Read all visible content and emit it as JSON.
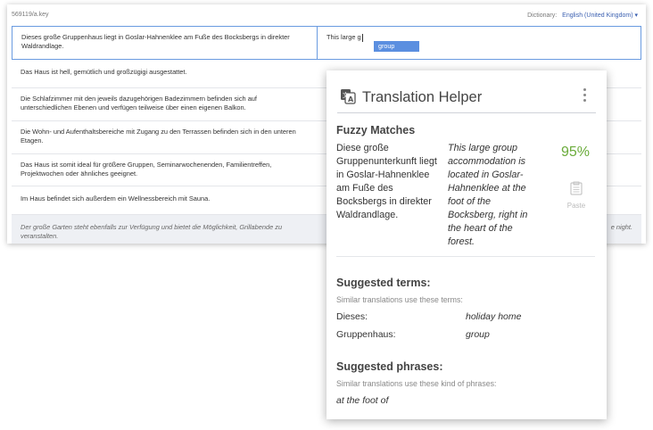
{
  "editor": {
    "file_name": "569119/a.key",
    "dictionary_label": "Dictionary:",
    "dictionary_value": "English (United Kingdom) ▾",
    "rows": [
      {
        "source": "Dieses große Gruppenhaus liegt in Goslar-Hahnenklee am Fuße des Bocksbergs in direkter Waldrandlage.",
        "target": "This large g"
      },
      {
        "source": "Das Haus ist hell, gemütlich und großzügigi ausgestattet.",
        "target": ""
      },
      {
        "source": "Die Schlafzimmer mit den jeweils dazugehörigen Badezimmern befinden sich auf unterschiedlichen Ebenen und verfügen teilweise über einen eigenen Balkon.",
        "target": ""
      },
      {
        "source": "Die Wohn- und Aufenthaltsbereiche mit Zugang zu den Terrassen befinden sich in den unteren Etagen.",
        "target": ""
      },
      {
        "source": "Das Haus ist somit ideal für größere Gruppen, Seminarwochenenden, Familientreffen, Projektwochen oder ähnliches geeignet.",
        "target": ""
      },
      {
        "source": "Im Haus befindet sich außerdem ein Wellnessbereich mit Sauna.",
        "target": ""
      },
      {
        "source": "Der große Garten steht ebenfalls zur Verfügung und bietet die Möglichkeit, Grillabende zu veranstalten.",
        "target": "e night."
      }
    ],
    "autocomplete": "group"
  },
  "helper": {
    "title": "Translation Helper",
    "fuzzy": {
      "heading": "Fuzzy Matches",
      "source": "Diese große Gruppenunterkunft liegt in Goslar-Hahnenklee am Fuße des Bocksbergs in direkter Waldrandlage.",
      "target": "This large group accommodation is located in Goslar-Hahnenklee at the foot of the Bocksberg, right in the heart of the forest.",
      "percent": "95%",
      "paste_label": "Paste"
    },
    "terms": {
      "heading": "Suggested terms:",
      "subtitle": "Similar translations use these terms:",
      "items": [
        {
          "source": "Dieses:",
          "target": "holiday home"
        },
        {
          "source": "Gruppenhaus:",
          "target": "group"
        }
      ]
    },
    "phrases": {
      "heading": "Suggested phrases:",
      "subtitle": "Similar translations use these kind of phrases:",
      "items": [
        "at the foot of"
      ]
    }
  }
}
